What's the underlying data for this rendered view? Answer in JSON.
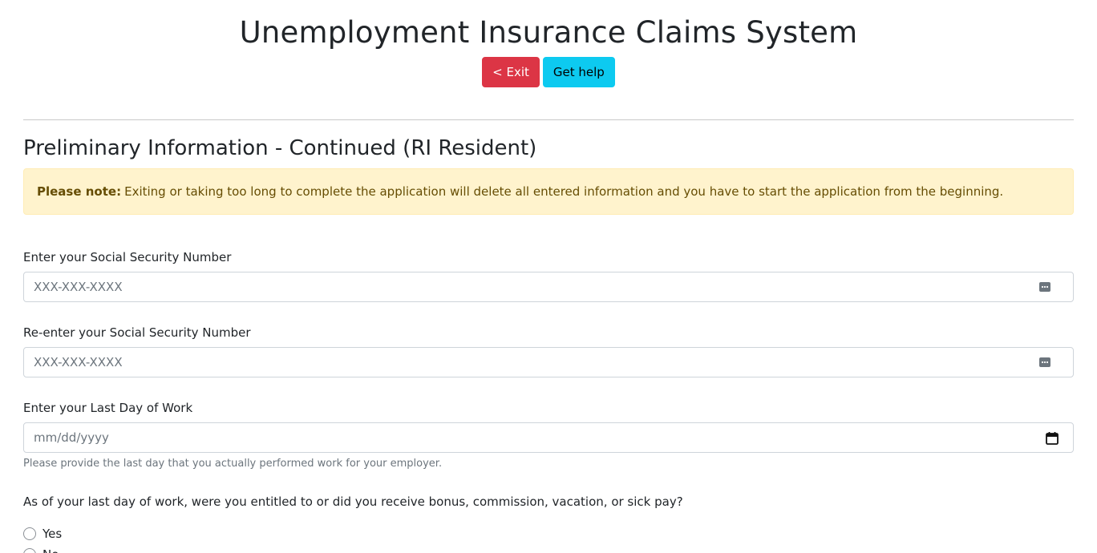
{
  "app": {
    "title": "Unemployment Insurance Claims System",
    "exit_label": "< Exit",
    "help_label": "Get help"
  },
  "page": {
    "section_title": "Preliminary Information - Continued (RI Resident)"
  },
  "alert": {
    "bold": "Please note:",
    "text": "Exiting or taking too long to complete the application will delete all entered information and you have to start the application from the beginning."
  },
  "fields": {
    "ssn": {
      "label": "Enter your Social Security Number",
      "placeholder": "XXX-XXX-XXXX",
      "icon": "password-dots-icon"
    },
    "ssn_confirm": {
      "label": "Re-enter your Social Security Number",
      "placeholder": "XXX-XXX-XXXX",
      "icon": "password-dots-icon"
    },
    "last_day": {
      "label": "Enter your Last Day of Work",
      "placeholder": "mm/dd/yyyy",
      "icon": "calendar-icon",
      "help": "Please provide the last day that you actually performed work for your employer."
    }
  },
  "question": {
    "text": "As of your last day of work, were you entitled to or did you receive bonus, commission, vacation, or sick pay?",
    "options": [
      {
        "label": "Yes"
      },
      {
        "label": "No"
      }
    ]
  },
  "colors": {
    "danger": "#dc3545",
    "info": "#0dcaf0",
    "warning_bg": "#fff3cd",
    "warning_text": "#664d03"
  }
}
